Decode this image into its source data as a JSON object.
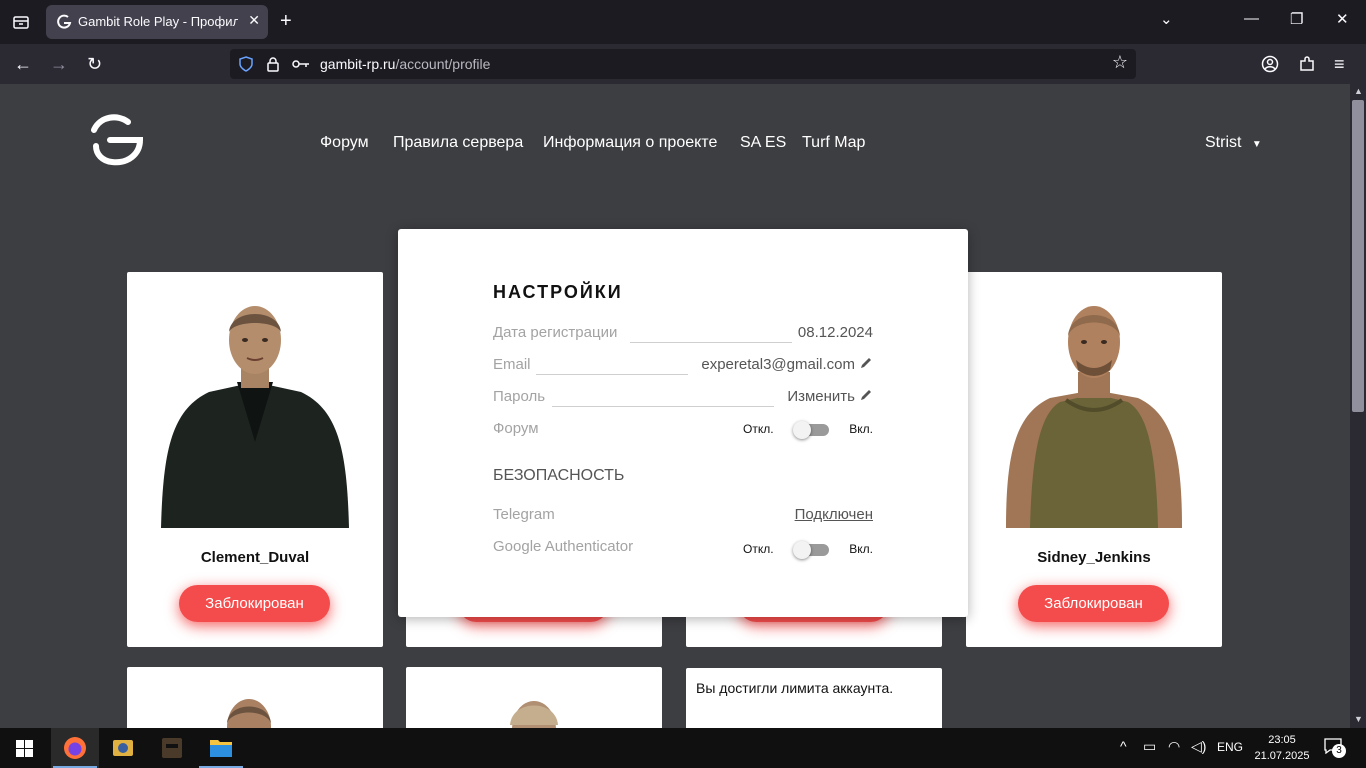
{
  "browser": {
    "tab_title": "Gambit Role Play - Профиль UCP",
    "url_host": "gambit-rp.ru",
    "url_path": "/account/profile"
  },
  "site": {
    "nav": [
      "Форум",
      "Правила сервера",
      "Информация о проекте",
      "SA ES",
      "Turf Map"
    ],
    "username": "Strist"
  },
  "characters": [
    {
      "name": "Clement_Duval",
      "status": "Заблокирован"
    },
    {
      "name": "Sidney_Jenkins",
      "status": "Заблокирован"
    }
  ],
  "settings": {
    "title": "НАСТРОЙКИ",
    "reg_label": "Дата регистрации",
    "reg_value": "08.12.2024",
    "email_label": "Email",
    "email_value": "experetal3@gmail.com",
    "password_label": "Пароль",
    "password_value": "Изменить",
    "forum_label": "Форум",
    "off": "Откл.",
    "on": "Вкл.",
    "security_title": "БЕЗОПАСНОСТЬ",
    "telegram_label": "Telegram",
    "telegram_value": "Подключен",
    "ga_label": "Google Authenticator"
  },
  "limit_text": "Вы достигли лимита аккаунта.",
  "taskbar": {
    "lang": "ENG",
    "time": "23:05",
    "date": "21.07.2025",
    "notifications": "3"
  }
}
